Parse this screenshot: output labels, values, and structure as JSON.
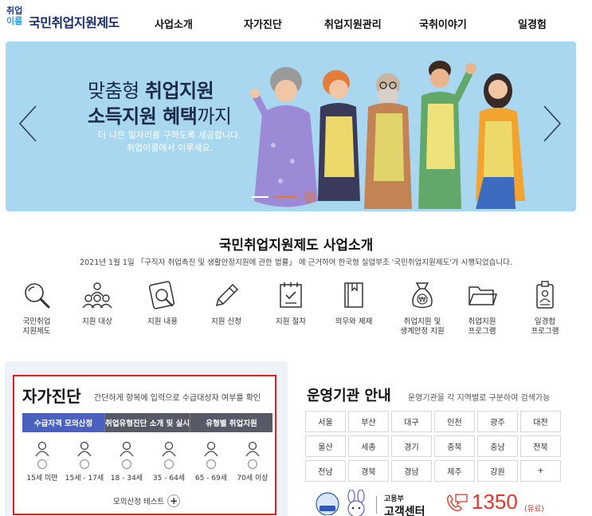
{
  "header": {
    "logo_top": "취업",
    "logo_bottom": "이룸",
    "logo_text": "국민취업지원제도",
    "nav": [
      "사업소개",
      "자가진단",
      "취업지원관리",
      "국취이야기",
      "일경험"
    ]
  },
  "banner": {
    "line1_plain": "맞춤형 ",
    "line1_bold": "취업지원",
    "line2_bold": "소득지원 혜택",
    "line2_plain": "까지",
    "sub1": "더 나은 일자리를 구하도록 세공합니다.",
    "sub2": "취업이룸에서 이루세요."
  },
  "intro": {
    "title": "국민취업지원제도 사업소개",
    "desc": "2021년 1월 1일 「구직자 취업촉진 및 생활안정지원에 관한 법률」 에 근거하여 한국형 실업부조 '국민취업지원제도'가 시행되었습니다.",
    "items": [
      {
        "label": "국민취업\n지원제도",
        "icon": "magnifier-icon"
      },
      {
        "label": "지원 대상",
        "icon": "people-group-icon"
      },
      {
        "label": "지원 내용",
        "icon": "document-search-icon"
      },
      {
        "label": "지원 신청",
        "icon": "pencil-icon"
      },
      {
        "label": "지원 절차",
        "icon": "checklist-icon"
      },
      {
        "label": "의무와 제재",
        "icon": "book-icon"
      },
      {
        "label": "취업지원 및\n생계안정 지원",
        "icon": "money-bag-icon"
      },
      {
        "label": "취업지원\n프로그램",
        "icon": "folder-icon"
      },
      {
        "label": "일경험\n프로그램",
        "icon": "id-badge-icon"
      }
    ]
  },
  "self_check": {
    "title": "자가진단",
    "desc": "간단하게 항목에 입력으로 수급대상자 여부를 확인",
    "tabs": [
      "수급자격 모의산정",
      "취업유형진단 소개 및 실시",
      "유형별 취업지원"
    ],
    "ages": [
      "15세 미만",
      "15세 - 17세",
      "18 - 34세",
      "35 - 64세",
      "65 - 69세",
      "70세 이상"
    ],
    "test_label": "모의산정 테스트",
    "test_plus": "+"
  },
  "agencies": {
    "title": "운영기관 안내",
    "desc": "운영기관을 각 지역별로 구분하여 검색가능",
    "regions": [
      "서울",
      "부산",
      "대구",
      "인천",
      "광주",
      "대전",
      "울산",
      "세종",
      "경기",
      "충북",
      "충남",
      "전북",
      "전남",
      "경북",
      "경남",
      "제주",
      "강원",
      "+"
    ],
    "call_org": "고용부",
    "call_center": "고객센터",
    "call_number": "1350",
    "call_paid": "(유료)"
  },
  "colors": {
    "banner_bg": "#a9d7ef",
    "tab_active": "#4a61bf",
    "tab_inactive": "#555a66",
    "highlight_border": "#e02020",
    "phone_red": "#e8352b",
    "logo_navy": "#1a2d6b"
  }
}
